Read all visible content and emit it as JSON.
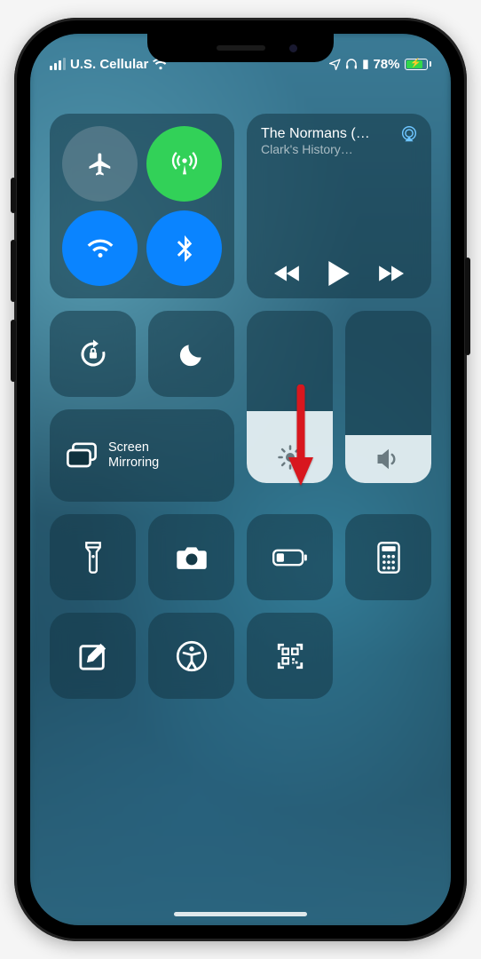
{
  "status": {
    "carrier": "U.S. Cellular",
    "battery_pct": "78%"
  },
  "media": {
    "title": "The Normans (…",
    "subtitle": "Clark's History…"
  },
  "screen_mirroring": {
    "label_l1": "Screen",
    "label_l2": "Mirroring"
  },
  "sliders": {
    "brightness_pct": 42,
    "volume_pct": 28
  },
  "connectivity": {
    "airplane": false,
    "cellular": true,
    "wifi": true,
    "bluetooth": true
  },
  "toggles": {
    "rotation_lock": false,
    "dnd": false
  },
  "shortcuts": [
    "flashlight",
    "camera",
    "low-power",
    "calculator",
    "notes",
    "accessibility",
    "qr-scan"
  ]
}
